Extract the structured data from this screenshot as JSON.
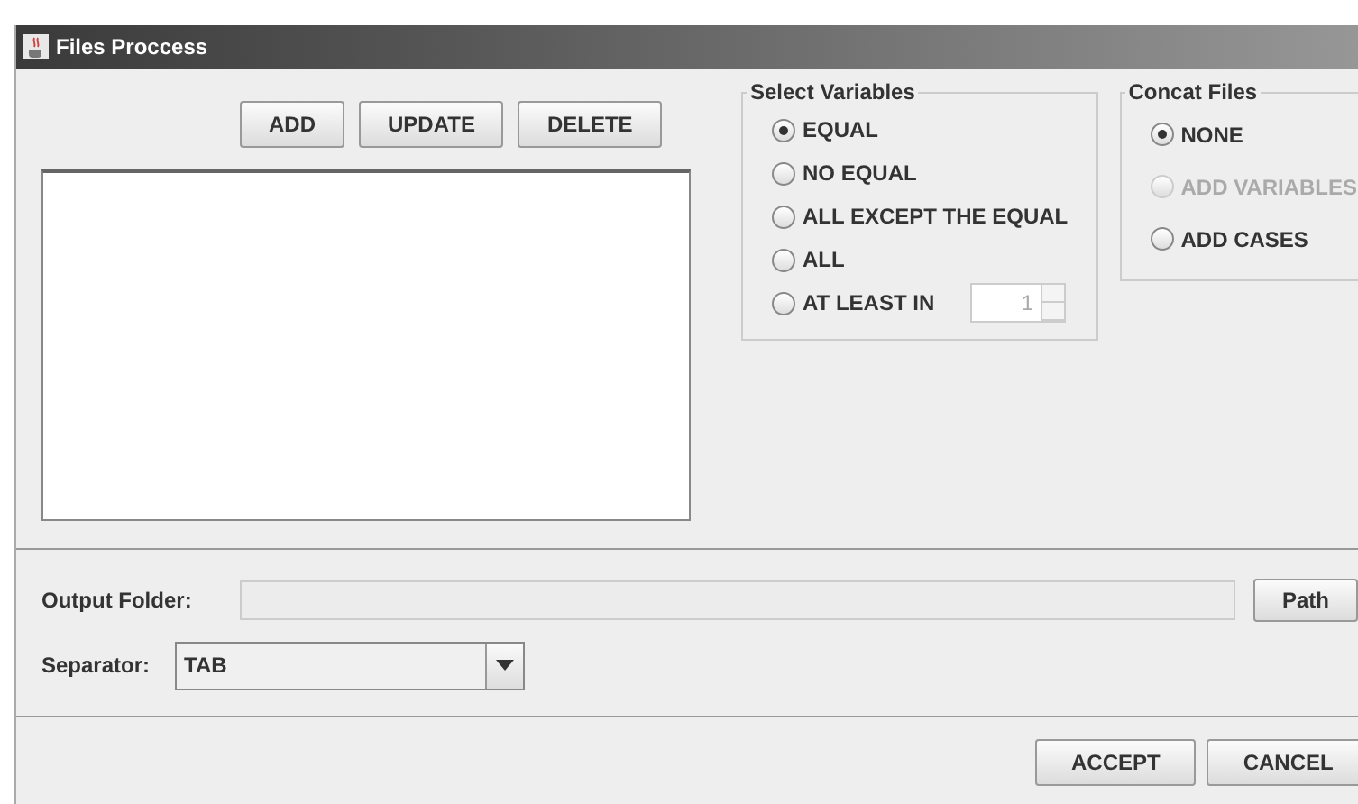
{
  "window": {
    "title": "Files Proccess"
  },
  "toolbar": [
    "ADD",
    "UPDATE",
    "DELETE"
  ],
  "select_variables": {
    "title": "Select Variables",
    "options": [
      {
        "label": "EQUAL",
        "selected": true,
        "kind": "radio"
      },
      {
        "label": "NO EQUAL",
        "selected": false,
        "kind": "radio"
      },
      {
        "label": "ALL EXCEPT THE EQUAL",
        "selected": false,
        "kind": "radio"
      },
      {
        "label": "ALL",
        "selected": false,
        "kind": "radio"
      },
      {
        "label": "AT LEAST IN",
        "selected": false,
        "kind": "spinner",
        "value": "1",
        "disabled": true
      }
    ]
  },
  "concat_files": {
    "title": "Concat Files",
    "options": [
      {
        "label": "NONE",
        "selected": true,
        "disabled": false
      },
      {
        "label": "ADD VARIABLES",
        "selected": false,
        "disabled": true
      },
      {
        "label": "ADD CASES",
        "selected": false,
        "disabled": false
      }
    ]
  },
  "output_folder": {
    "label": "Output Folder:",
    "button": "Path"
  },
  "separator": {
    "label": "Separator:",
    "value": "TAB"
  },
  "buttons": [
    "ACCEPT",
    "CANCEL"
  ]
}
